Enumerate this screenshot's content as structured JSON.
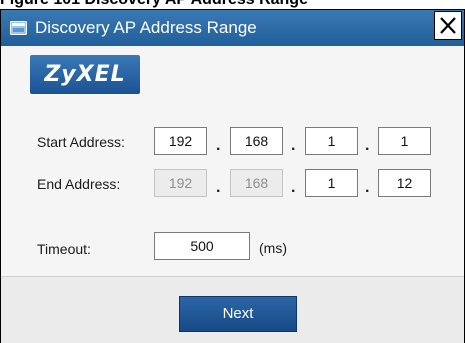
{
  "caption": "Figure 101   Discovery AP Address Range",
  "window": {
    "title": "Discovery AP Address Range",
    "close_icon": "close-icon",
    "title_bar_color": "#2a6aa8"
  },
  "logo": {
    "text": "ZyXEL",
    "color": "#1f5fa8"
  },
  "form": {
    "start": {
      "label": "Start Address:",
      "octets": [
        "192",
        "168",
        "1",
        "1"
      ]
    },
    "end": {
      "label": "End Address:",
      "octets": [
        "192",
        "168",
        "1",
        "12"
      ],
      "disabled_octets": [
        true,
        true,
        false,
        false
      ]
    },
    "separator": ".",
    "timeout": {
      "label": "Timeout:",
      "value": "500",
      "unit": "(ms)"
    }
  },
  "footer": {
    "next_label": "Next",
    "button_color": "#1f5594"
  }
}
